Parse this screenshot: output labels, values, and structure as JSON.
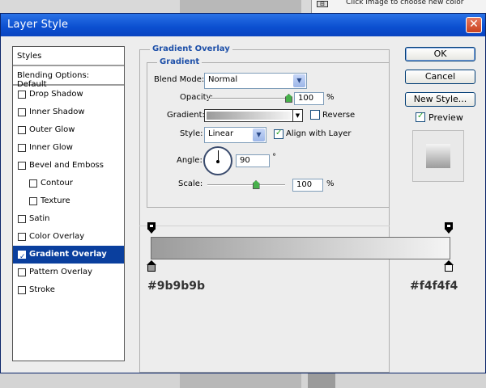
{
  "background": {
    "hint_text": "Click image to choose new color"
  },
  "dialog": {
    "title": "Layer Style",
    "close_glyph": "✕"
  },
  "styles_list": {
    "header": "Styles",
    "blending_options": "Blending Options: Default",
    "items": [
      {
        "label": "Drop Shadow",
        "checked": false,
        "sub": false,
        "selected": false
      },
      {
        "label": "Inner Shadow",
        "checked": false,
        "sub": false,
        "selected": false
      },
      {
        "label": "Outer Glow",
        "checked": false,
        "sub": false,
        "selected": false
      },
      {
        "label": "Inner Glow",
        "checked": false,
        "sub": false,
        "selected": false
      },
      {
        "label": "Bevel and Emboss",
        "checked": false,
        "sub": false,
        "selected": false
      },
      {
        "label": "Contour",
        "checked": false,
        "sub": true,
        "selected": false
      },
      {
        "label": "Texture",
        "checked": false,
        "sub": true,
        "selected": false
      },
      {
        "label": "Satin",
        "checked": false,
        "sub": false,
        "selected": false
      },
      {
        "label": "Color Overlay",
        "checked": false,
        "sub": false,
        "selected": false
      },
      {
        "label": "Gradient Overlay",
        "checked": true,
        "sub": false,
        "selected": true
      },
      {
        "label": "Pattern Overlay",
        "checked": false,
        "sub": false,
        "selected": false
      },
      {
        "label": "Stroke",
        "checked": false,
        "sub": false,
        "selected": false
      }
    ]
  },
  "gradient_overlay": {
    "section_title": "Gradient Overlay",
    "group_title": "Gradient",
    "blend_mode_label": "Blend Mode:",
    "blend_mode_value": "Normal",
    "opacity_label": "Opacity:",
    "opacity_value": "100",
    "opacity_unit": "%",
    "opacity_level": 1.0,
    "gradient_label": "Gradient:",
    "reverse_label": "Reverse",
    "reverse_checked": false,
    "style_label": "Style:",
    "style_value": "Linear",
    "align_label": "Align with Layer",
    "align_checked": true,
    "angle_label": "Angle:",
    "angle_value": "90",
    "angle_unit": "°",
    "scale_label": "Scale:",
    "scale_value": "100",
    "scale_unit": "%",
    "scale_level": 0.62
  },
  "buttons": {
    "ok": "OK",
    "cancel": "Cancel",
    "new_style": "New Style...",
    "preview_label": "Preview",
    "preview_checked": true
  },
  "gradient_editor": {
    "left_color": "#9b9b9b",
    "right_color": "#f4f4f4",
    "left_label": "#9b9b9b",
    "right_label": "#f4f4f4"
  },
  "colors": {
    "title_bar": "#0b4fd0",
    "selection": "#0a3f9e",
    "group_title": "#1d4fa8"
  }
}
